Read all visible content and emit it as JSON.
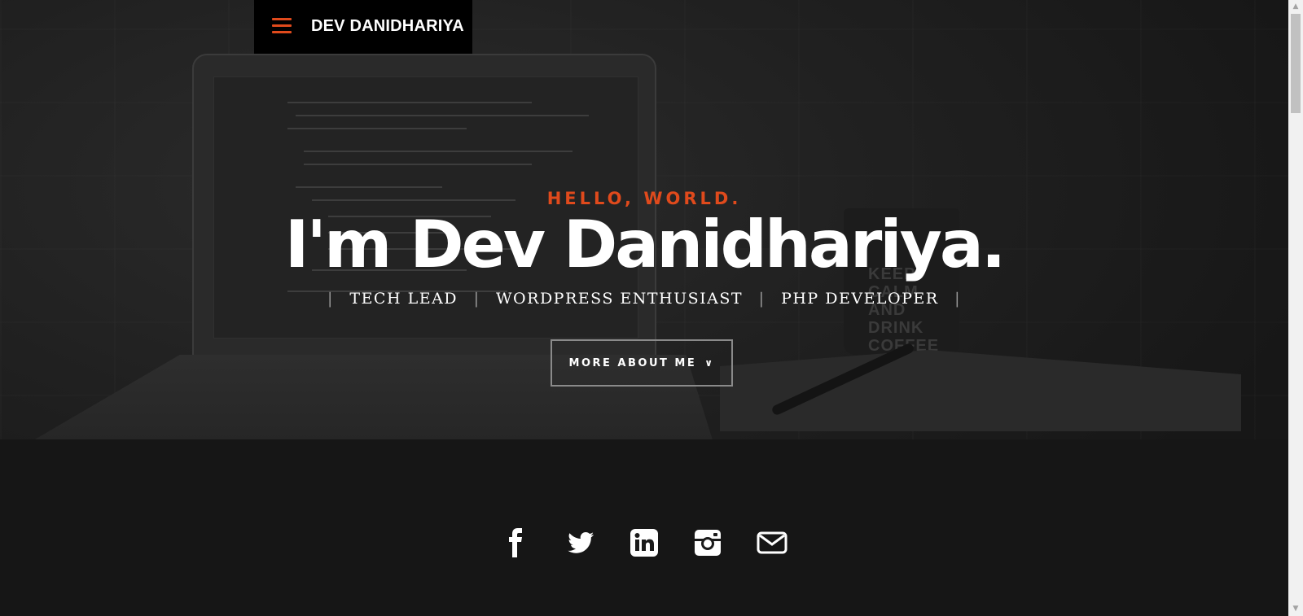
{
  "header": {
    "brand": "DEV DANIDHARIYA",
    "menu_icon": "hamburger-menu-icon",
    "accent_color": "#e04a1c"
  },
  "hero": {
    "kicker": "HELLO, WORLD.",
    "headline": "I'm Dev Danidhariya.",
    "roles": [
      "TECH LEAD",
      "WORDPRESS ENTHUSIAST",
      "PHP DEVELOPER"
    ],
    "cta_label": "MORE ABOUT ME",
    "cta_icon": "chevron-down-icon",
    "mug_text": "KEEP CALM AND DRINK COFFEE"
  },
  "social": [
    {
      "name": "facebook-icon"
    },
    {
      "name": "twitter-icon"
    },
    {
      "name": "linkedin-icon"
    },
    {
      "name": "instagram-icon"
    },
    {
      "name": "envelope-icon"
    }
  ]
}
